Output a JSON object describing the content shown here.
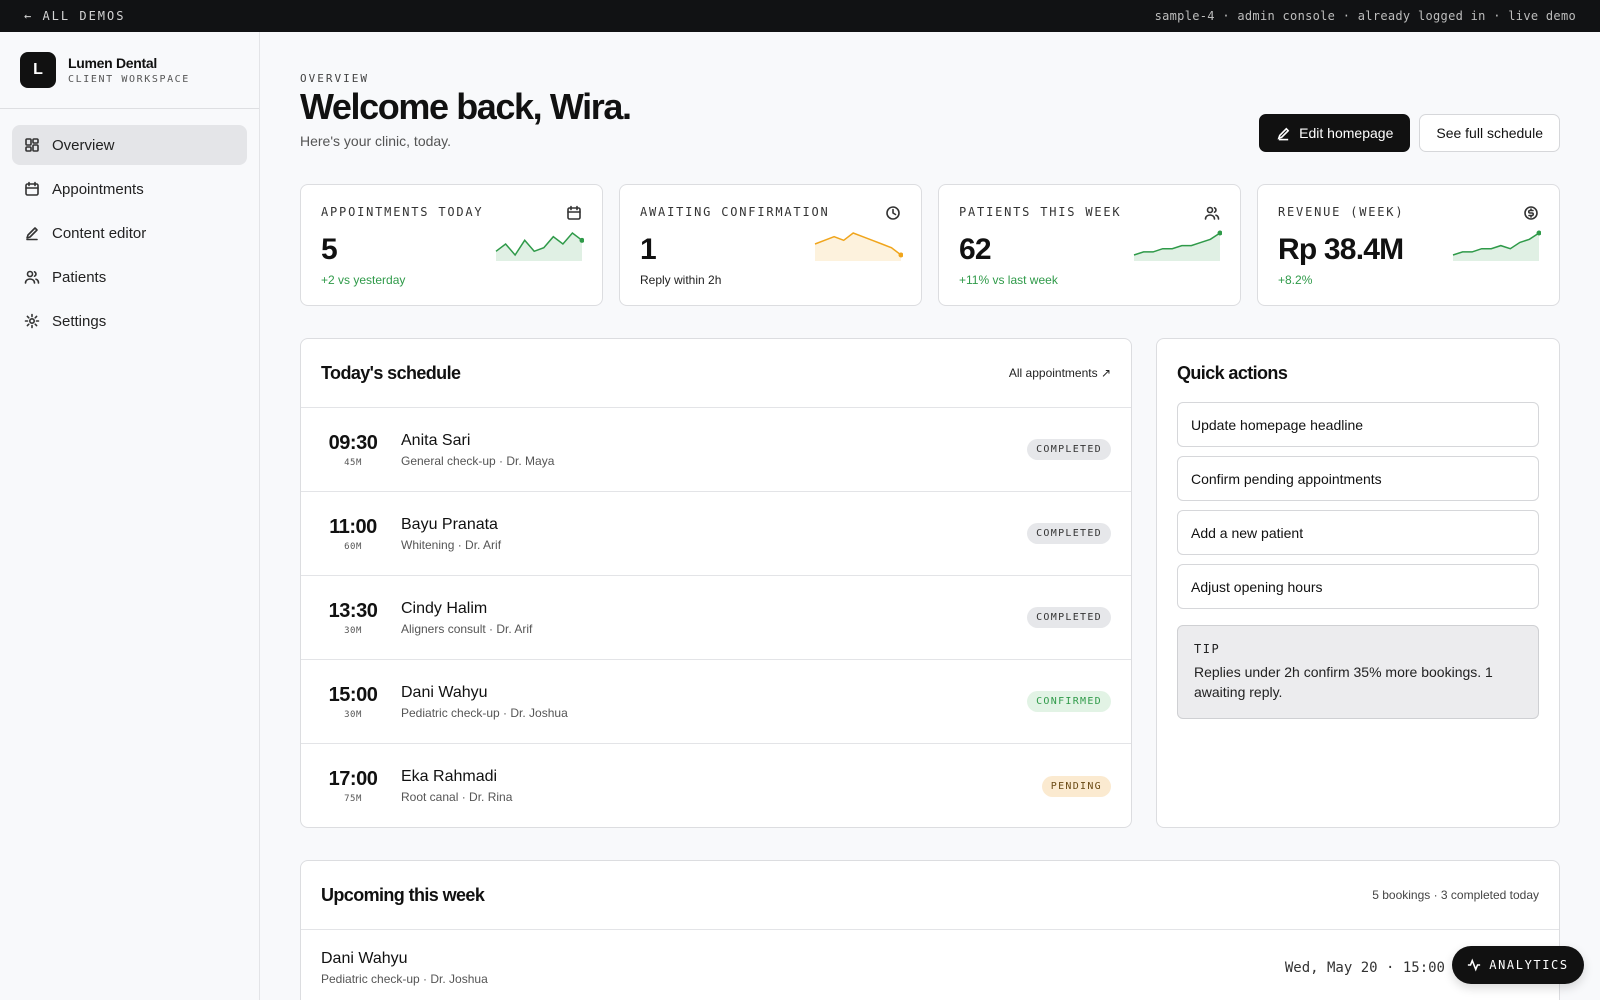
{
  "topbar": {
    "back_label": "← ALL DEMOS",
    "meta": "sample-4 · admin console · already logged in · live demo"
  },
  "brand": {
    "logo_letter": "L",
    "name": "Lumen Dental",
    "subtitle": "CLIENT WORKSPACE"
  },
  "nav": {
    "items": [
      {
        "label": "Overview",
        "icon": "grid-icon",
        "active": true
      },
      {
        "label": "Appointments",
        "icon": "calendar-icon"
      },
      {
        "label": "Content editor",
        "icon": "pencil-icon"
      },
      {
        "label": "Patients",
        "icon": "users-icon"
      },
      {
        "label": "Settings",
        "icon": "gear-icon"
      }
    ]
  },
  "header": {
    "eyebrow": "OVERVIEW",
    "title": "Welcome back, Wira.",
    "subtitle": "Here's your clinic, today.",
    "edit_label": "Edit homepage",
    "schedule_label": "See full schedule"
  },
  "stats": [
    {
      "label": "APPOINTMENTS TODAY",
      "value": "5",
      "note": "+2 vs yesterday",
      "icon": "calendar-icon",
      "color": "#2f9a49",
      "trend": [
        4,
        6,
        3,
        7,
        4,
        5,
        8,
        6,
        9,
        7
      ]
    },
    {
      "label": "AWAITING CONFIRMATION",
      "value": "1",
      "note": "Reply within 2h",
      "icon": "clock-icon",
      "color": "#f0a51c",
      "trend": [
        5,
        6,
        7,
        6,
        8,
        7,
        6,
        5,
        4,
        2
      ]
    },
    {
      "label": "PATIENTS THIS WEEK",
      "value": "62",
      "note": "+11% vs last week",
      "icon": "users-icon",
      "color": "#2f9a49",
      "trend": [
        2,
        3,
        3,
        4,
        4,
        5,
        5,
        6,
        7,
        9
      ]
    },
    {
      "label": "REVENUE (WEEK)",
      "value": "Rp 38.4M",
      "note": "+8.2%",
      "icon": "dollar-icon",
      "color": "#2f9a49",
      "trend": [
        2,
        3,
        3,
        4,
        4,
        5,
        4,
        6,
        7,
        9
      ]
    }
  ],
  "schedule": {
    "title": "Today's schedule",
    "link_label": "All appointments ↗",
    "rows": [
      {
        "time": "09:30",
        "duration": "45M",
        "name": "Anita Sari",
        "desc": "General check-up · Dr. Maya",
        "status": "COMPLETED",
        "kind": "completed"
      },
      {
        "time": "11:00",
        "duration": "60M",
        "name": "Bayu Pranata",
        "desc": "Whitening · Dr. Arif",
        "status": "COMPLETED",
        "kind": "completed"
      },
      {
        "time": "13:30",
        "duration": "30M",
        "name": "Cindy Halim",
        "desc": "Aligners consult · Dr. Arif",
        "status": "COMPLETED",
        "kind": "completed"
      },
      {
        "time": "15:00",
        "duration": "30M",
        "name": "Dani Wahyu",
        "desc": "Pediatric check-up · Dr. Joshua",
        "status": "CONFIRMED",
        "kind": "confirmed"
      },
      {
        "time": "17:00",
        "duration": "75M",
        "name": "Eka Rahmadi",
        "desc": "Root canal · Dr. Rina",
        "status": "PENDING",
        "kind": "pending"
      }
    ]
  },
  "quick": {
    "title": "Quick actions",
    "actions": [
      "Update homepage headline",
      "Confirm pending appointments",
      "Add a new patient",
      "Adjust opening hours"
    ],
    "tip_label": "TIP",
    "tip_text": "Replies under 2h confirm 35% more bookings. 1 awaiting reply."
  },
  "upcoming": {
    "title": "Upcoming this week",
    "meta": "5 bookings · 3 completed today",
    "rows": [
      {
        "name": "Dani Wahyu",
        "desc": "Pediatric check-up · Dr. Joshua",
        "when": "Wed, May 20 · 15:00"
      }
    ]
  },
  "analytics_label": "ANALYTICS"
}
